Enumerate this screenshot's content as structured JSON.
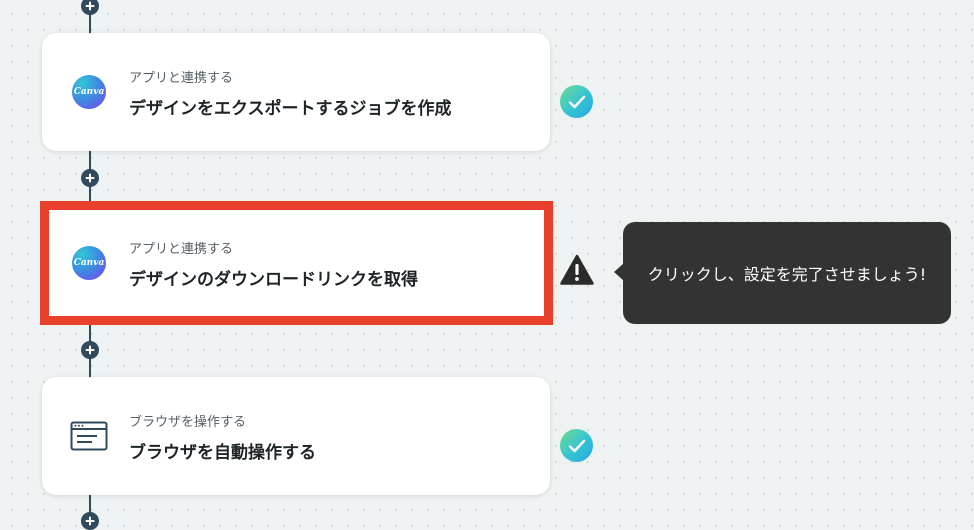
{
  "flow": {
    "steps": [
      {
        "category": "アプリと連携する",
        "title": "デザインをエクスポートするジョブを作成",
        "app_icon_text": "Canva",
        "app_icon": "canva-logo-icon",
        "status": "complete",
        "status_icon": "check-icon"
      },
      {
        "category": "アプリと連携する",
        "title": "デザインのダウンロードリンクを取得",
        "app_icon_text": "Canva",
        "app_icon": "canva-logo-icon",
        "status": "warning",
        "status_icon": "warning-icon"
      },
      {
        "category": "ブラウザを操作する",
        "title": "ブラウザを自動操作する",
        "app_icon": "browser-window-icon",
        "status": "complete",
        "status_icon": "check-icon"
      }
    ]
  },
  "tooltip": {
    "text": "クリックし、設定を完了させましょう!"
  },
  "colors": {
    "highlight_border": "#e8402a",
    "flow_line": "#2f4a5c",
    "tooltip_bg": "#333333",
    "check_gradient_start": "#6fdc8c",
    "check_gradient_end": "#2aa3e0"
  }
}
